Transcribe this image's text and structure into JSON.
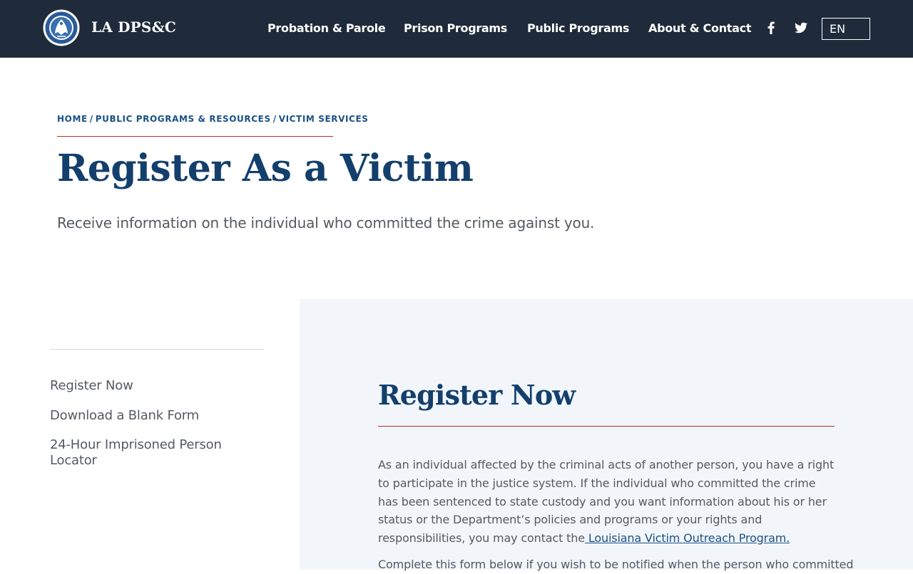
{
  "header": {
    "brand": "LA DPS&C",
    "nav": [
      {
        "label": "Probation & Parole"
      },
      {
        "label": "Prison Programs"
      },
      {
        "label": "Public Programs"
      },
      {
        "label": "About & Contact"
      }
    ],
    "social": [
      "facebook-icon",
      "twitter-icon"
    ],
    "language": "EN"
  },
  "breadcrumb": {
    "items": [
      "HOME",
      "PUBLIC PROGRAMS & RESOURCES",
      "VICTIM SERVICES"
    ],
    "separator": "/"
  },
  "page": {
    "title": "Register As a Victim",
    "subtitle": "Receive information on the individual who committed the crime against you."
  },
  "sidebar": {
    "items": [
      {
        "label": "Register Now"
      },
      {
        "label": "Download a Blank Form"
      },
      {
        "label": "24-Hour Imprisoned Person Locator"
      }
    ]
  },
  "main": {
    "title": "Register Now",
    "paragraph1": "As an individual affected by the criminal acts of another person, you have a right to participate in the justice system. If the individual who committed the crime has been sentenced to state custody and you want information about his or her status or the Department’s policies and programs or your rights and responsibilities, you may contact the",
    "paragraph1_link": " Louisiana Victim Outreach Program.",
    "paragraph2": "Complete this form below if you wish to be notified when the person who committed"
  },
  "colors": {
    "header_bg": "#1f2b3a",
    "title_blue": "#133f6c",
    "link_blue": "#1b5186",
    "accent_red": "#b4302a",
    "panel_bg": "#f2f6fb"
  }
}
